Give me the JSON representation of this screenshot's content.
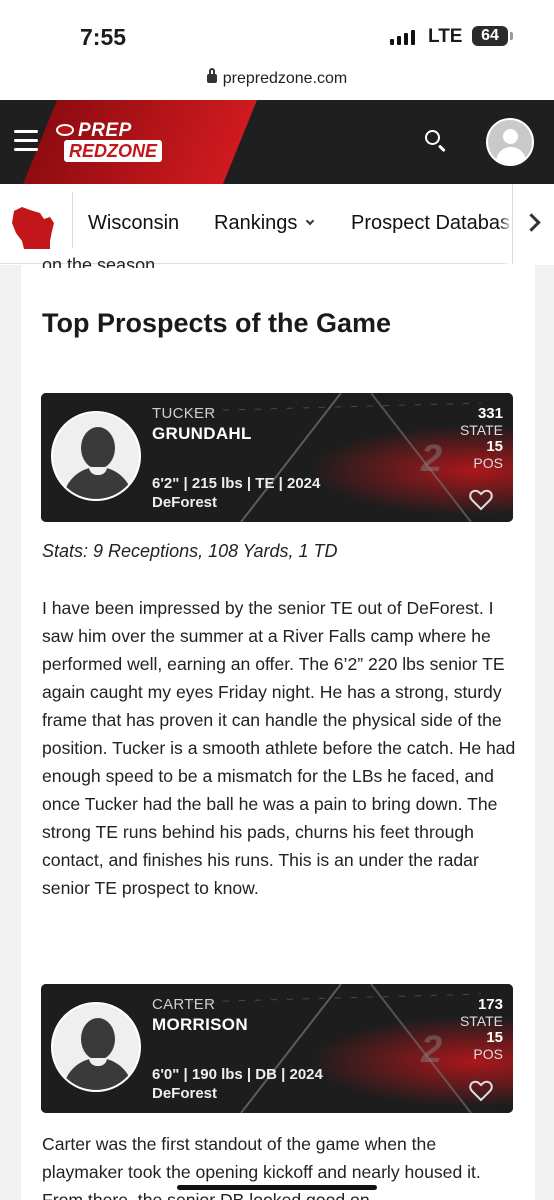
{
  "status_bar": {
    "time": "7:55",
    "network": "LTE",
    "battery": "64"
  },
  "url_bar": {
    "domain": "prepredzone.com"
  },
  "header": {
    "logo_line1": "PREP",
    "logo_line2": "REDZONE",
    "colors": {
      "header_bg": "#1f1f1f",
      "brand_red": "#c3161b"
    }
  },
  "subnav": {
    "items": [
      "Wisconsin",
      "Rankings",
      "Prospect Databas"
    ]
  },
  "article": {
    "clipped_text": "on the season.",
    "section_title": "Top Prospects of the Game",
    "prospects": [
      {
        "first_name": "TUCKER",
        "last_name": "GRUNDAHL",
        "measurables": "6'2\" | 215 lbs | TE | 2024",
        "school": "DeForest",
        "state_rank": "331",
        "state_label": "STATE",
        "pos_rank": "15",
        "pos_label": "POS",
        "stats": "Stats: 9 Receptions, 108 Yards, 1 TD",
        "paragraph": "I have been impressed by the senior TE out of DeForest. I saw him over the summer at a River Falls camp where he performed well, earning an offer. The 6’2” 220 lbs senior TE again caught my eyes Friday night. He has a strong, sturdy frame that has proven it can handle the physical side of the position. Tucker is a smooth athlete before the catch. He had enough speed to be a mismatch for the LBs he faced, and once Tucker had the ball he was a pain to bring down. The strong TE runs behind his pads, churns his feet through contact, and finishes his runs. This is an under the radar senior TE prospect to know."
      },
      {
        "first_name": "CARTER",
        "last_name": "MORRISON",
        "measurables": "6'0\" | 190 lbs | DB | 2024",
        "school": "DeForest",
        "state_rank": "173",
        "state_label": "STATE",
        "pos_rank": "15",
        "pos_label": "POS",
        "paragraph": "Carter was the first standout of the game when the playmaker took the opening kickoff and nearly housed it. From there, the senior DB looked good on"
      }
    ]
  },
  "icons": {
    "menu": "hamburger-icon",
    "search": "search-icon",
    "account": "avatar-icon",
    "state": "wisconsin-state-icon",
    "more": "chevron-right-icon",
    "favorite": "heart-icon"
  }
}
